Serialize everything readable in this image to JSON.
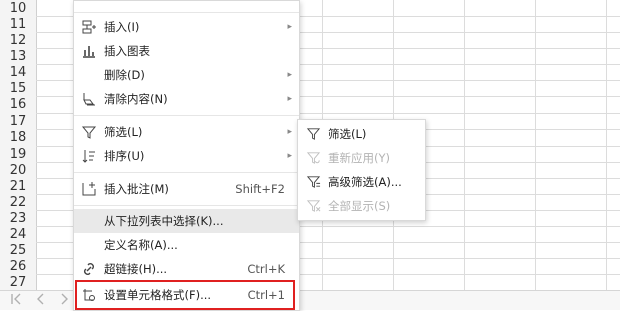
{
  "rows": [
    "10",
    "11",
    "12",
    "13",
    "14",
    "15",
    "16",
    "17",
    "18",
    "19",
    "20",
    "21",
    "22",
    "23",
    "24",
    "25",
    "26",
    "27"
  ],
  "menu": {
    "items": [
      {
        "label": "插入(I)",
        "icon": "insert-row-icon",
        "submenu": true
      },
      {
        "label": "插入图表",
        "icon": "chart-icon"
      },
      {
        "label": "删除(D)",
        "submenu": true
      },
      {
        "label": "清除内容(N)",
        "icon": "eraser-icon",
        "submenu": true
      },
      {
        "label": "筛选(L)",
        "icon": "filter-icon",
        "submenu": true
      },
      {
        "label": "排序(U)",
        "icon": "sort-icon",
        "submenu": true
      },
      {
        "label": "插入批注(M)",
        "icon": "comment-icon",
        "shortcut": "Shift+F2"
      },
      {
        "label": "从下拉列表中选择(K)..."
      },
      {
        "label": "定义名称(A)..."
      },
      {
        "label": "超链接(H)...",
        "icon": "link-icon",
        "shortcut": "Ctrl+K"
      },
      {
        "label": "设置单元格格式(F)...",
        "icon": "format-cells-icon",
        "shortcut": "Ctrl+1"
      }
    ]
  },
  "submenu": {
    "items": [
      {
        "label": "筛选(L)",
        "enabled": true
      },
      {
        "label": "重新应用(Y)",
        "enabled": false
      },
      {
        "label": "高级筛选(A)...",
        "enabled": true
      },
      {
        "label": "全部显示(S)",
        "enabled": false
      }
    ]
  },
  "sheet_nav": [
    "first-sheet-icon",
    "prev-sheet-icon",
    "next-sheet-icon"
  ],
  "colors": {
    "highlight": "#e9e9e9",
    "annotation_box": "#e02020"
  }
}
